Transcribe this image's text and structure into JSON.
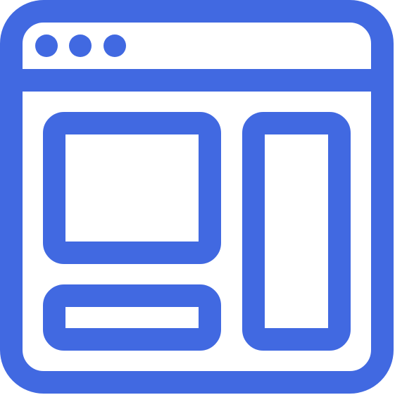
{
  "icon": {
    "name": "browser-window-layout-icon",
    "color": "#4169E1",
    "background": "#FFFFFF",
    "window_control_dots": 3,
    "content_panels": [
      "main-image-panel",
      "sidebar-panel",
      "footer-bar-panel"
    ]
  }
}
